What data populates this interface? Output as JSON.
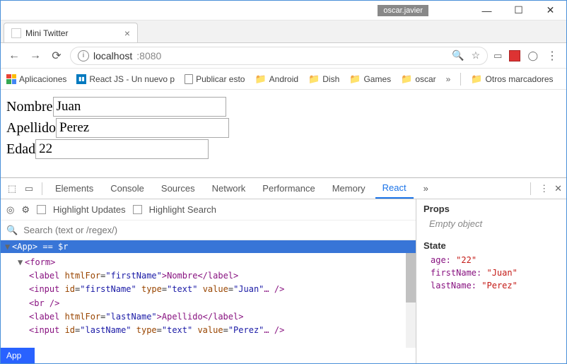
{
  "titlebar": {
    "user": "oscar.javier"
  },
  "tab": {
    "title": "Mini Twitter"
  },
  "address": {
    "host": "localhost",
    "port": ":8080"
  },
  "bookmarks": {
    "apps": "Aplicaciones",
    "react": "React JS - Un nuevo p",
    "publish": "Publicar esto",
    "android": "Android",
    "dish": "Dish",
    "games": "Games",
    "oscar": "oscar",
    "more": "»",
    "others": "Otros marcadores"
  },
  "form": {
    "firstName": {
      "label": "Nombre",
      "value": "Juan"
    },
    "lastName": {
      "label": "Apellido",
      "value": "Perez"
    },
    "age": {
      "label": "Edad",
      "value": "22"
    }
  },
  "devtools": {
    "tabs": {
      "elements": "Elements",
      "console": "Console",
      "sources": "Sources",
      "network": "Network",
      "performance": "Performance",
      "memory": "Memory",
      "react": "React",
      "more": "»"
    },
    "toolbar": {
      "hl_updates": "Highlight Updates",
      "hl_search": "Highlight Search"
    },
    "search_placeholder": "Search (text or /regex/)",
    "selected": "<App> == $r",
    "tree": {
      "l1": "<form>",
      "l2a": "<label ",
      "l2b": "htmlFor",
      "l2c": "=",
      "l2d": "\"firstName\"",
      "l2e": ">Nombre</label>",
      "l3a": "<input ",
      "l3b": "id",
      "l3c": "=",
      "l3d": "\"firstName\"",
      "l3e": " type",
      "l3f": "=",
      "l3g": "\"text\"",
      "l3h": " value",
      "l3i": "=",
      "l3j": "\"Juan\"",
      "l3k": "… />",
      "l4": "<br />",
      "l5a": "<label ",
      "l5b": "htmlFor",
      "l5c": "=",
      "l5d": "\"lastName\"",
      "l5e": ">Apellido</label>",
      "l6a": "<input ",
      "l6b": "id",
      "l6c": "=",
      "l6d": "\"lastName\"",
      "l6e": " type",
      "l6f": "=",
      "l6g": "\"text\"",
      "l6h": " value",
      "l6i": "=",
      "l6j": "\"Perez\"",
      "l6k": "… />"
    },
    "sidebar": {
      "props_title": "Props",
      "props_empty": "Empty object",
      "state_title": "State",
      "state": {
        "age_k": "age:",
        "age_v": "\"22\"",
        "fn_k": "firstName:",
        "fn_v": "\"Juan\"",
        "ln_k": "lastName:",
        "ln_v": "\"Perez\""
      }
    },
    "footer": "App"
  }
}
